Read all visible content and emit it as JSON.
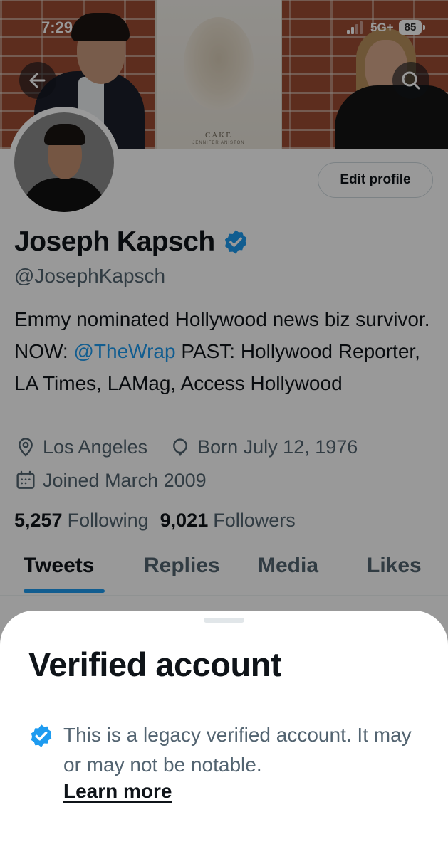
{
  "status_bar": {
    "time": "7:29",
    "network": "5G+",
    "battery": "85"
  },
  "banner": {
    "poster_title": "CAKE",
    "poster_subtitle": "JENNIFER ANISTON"
  },
  "header": {
    "back_icon": "arrow-left-icon",
    "search_icon": "search-icon"
  },
  "profile": {
    "edit_profile_label": "Edit profile",
    "display_name": "Joseph Kapsch",
    "handle": "@JosephKapsch",
    "bio_part1": "Emmy nominated Hollywood news biz survivor. NOW: ",
    "bio_mention": "@TheWrap",
    "bio_part2": " PAST: Hollywood Reporter, LA Times, LAMag, Access Hollywood",
    "location": "Los Angeles",
    "birthday": "Born July 12, 1976",
    "joined": "Joined March 2009",
    "following_count": "5,257",
    "following_label": "Following",
    "followers_count": "9,021",
    "followers_label": "Followers"
  },
  "tabs": [
    {
      "label": "Tweets",
      "active": true
    },
    {
      "label": "Replies",
      "active": false
    },
    {
      "label": "Media",
      "active": false
    },
    {
      "label": "Likes",
      "active": false
    }
  ],
  "sheet": {
    "title": "Verified account",
    "description": "This is a legacy verified account. It may or may not be notable.",
    "learn_more": "Learn more"
  },
  "colors": {
    "accent": "#1d9bf0",
    "text_primary": "#0f1419",
    "text_secondary": "#536471"
  }
}
